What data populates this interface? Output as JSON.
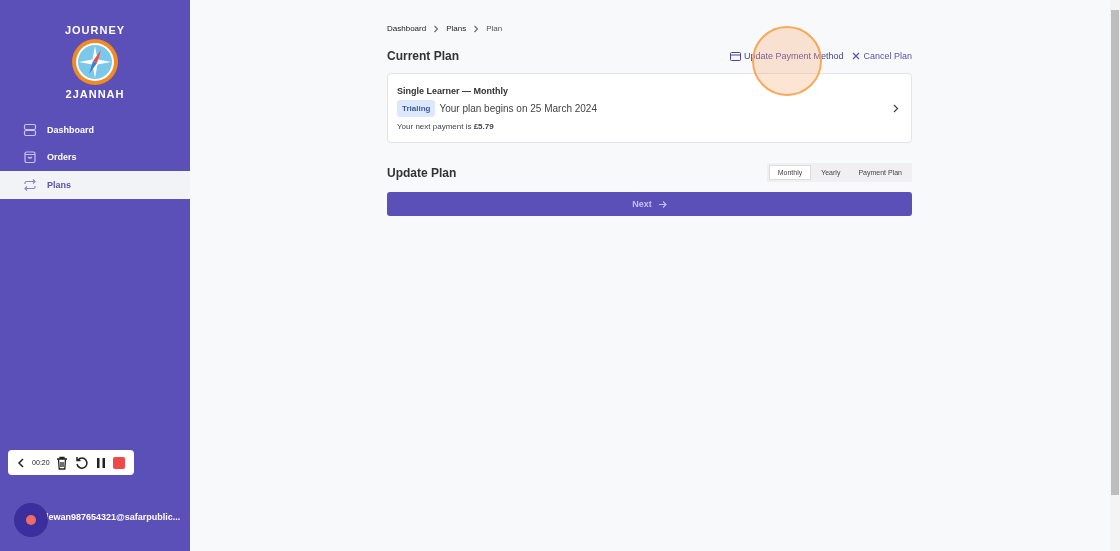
{
  "logo": {
    "top": "JOURNEY",
    "bottom": "2JANNAH"
  },
  "sidebar": {
    "items": [
      {
        "label": "Dashboard",
        "kind": "stack",
        "selected": false
      },
      {
        "label": "Orders",
        "kind": "bag",
        "selected": false
      },
      {
        "label": "Plans",
        "kind": "repeat",
        "selected": true
      }
    ],
    "user": "lewan987654321@safarpublic..."
  },
  "breadcrumbs": [
    "Dashboard",
    "Plans",
    "Plan"
  ],
  "current_plan": {
    "title": "Current Plan",
    "update_payment": "Update Payment Method",
    "cancel": "Cancel Plan",
    "name": "Single Learner — Monthly",
    "badge": "Trialing",
    "begins": "Your plan begins on 25 March 2024",
    "next_payment": "Your next payment is **£5.79**"
  },
  "update_plan": {
    "title": "Update Plan",
    "options": [
      {
        "label": "Monthly",
        "selected": true
      },
      {
        "label": "Yearly",
        "selected": false
      },
      {
        "label": "Payment Plan",
        "selected": false
      }
    ],
    "next": "Next"
  },
  "recorder": {
    "time": "00:20"
  }
}
